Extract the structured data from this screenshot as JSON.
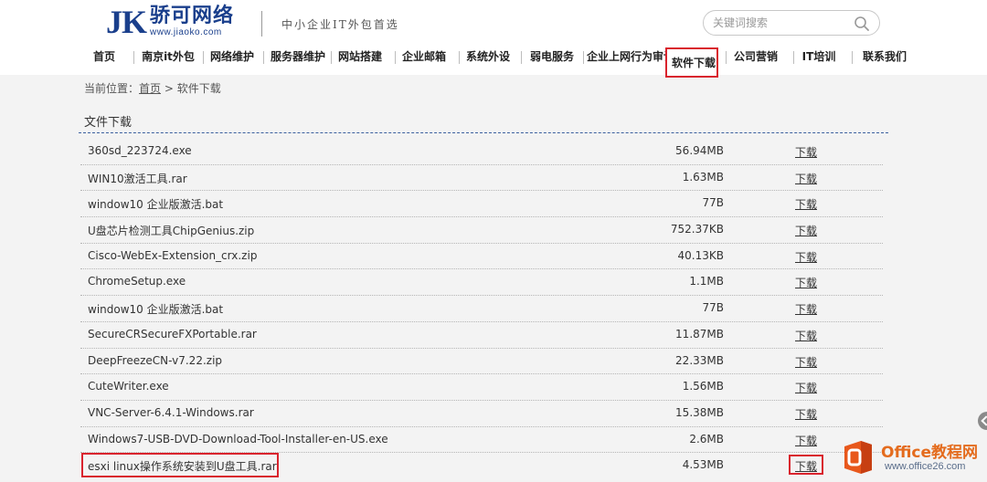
{
  "brand": {
    "logo_mark": "JK",
    "logo_name": "骄可网络",
    "logo_url": "www.jiaoko.com",
    "slogan": "中小企业IT外包首选"
  },
  "search": {
    "placeholder": "关键词搜索",
    "icon": "search-icon"
  },
  "nav": {
    "items": [
      {
        "label": "首页"
      },
      {
        "label": "南京it外包"
      },
      {
        "label": "网络维护"
      },
      {
        "label": "服务器维护"
      },
      {
        "label": "网站搭建"
      },
      {
        "label": "企业邮箱"
      },
      {
        "label": "系统外设"
      },
      {
        "label": "弱电服务"
      },
      {
        "label": "企业上网行为审计"
      },
      {
        "label": "软件下载",
        "active": true
      },
      {
        "label": "公司营销"
      },
      {
        "label": "IT培训"
      },
      {
        "label": "联系我们"
      }
    ]
  },
  "breadcrumb": {
    "prefix": "当前位置：",
    "home": "首页",
    "separator": ">",
    "current": "软件下载"
  },
  "section": {
    "title": "文件下载"
  },
  "files": [
    {
      "name": "360sd_223724.exe",
      "size": "56.94MB",
      "action": "下载"
    },
    {
      "name": "WIN10激活工具.rar",
      "size": "1.63MB",
      "action": "下载"
    },
    {
      "name": "window10 企业版激活.bat",
      "size": "77B",
      "action": "下载"
    },
    {
      "name": "U盘芯片检测工具ChipGenius.zip",
      "size": "752.37KB",
      "action": "下载"
    },
    {
      "name": "Cisco-WebEx-Extension_crx.zip",
      "size": "40.13KB",
      "action": "下载"
    },
    {
      "name": "ChromeSetup.exe",
      "size": "1.1MB",
      "action": "下载"
    },
    {
      "name": "window10 企业版激活.bat",
      "size": "77B",
      "action": "下载"
    },
    {
      "name": "SecureCRSecureFXPortable.rar",
      "size": "11.87MB",
      "action": "下载"
    },
    {
      "name": "DeepFreezeCN-v7.22.zip",
      "size": "22.33MB",
      "action": "下载"
    },
    {
      "name": "CuteWriter.exe",
      "size": "1.56MB",
      "action": "下载"
    },
    {
      "name": "VNC-Server-6.4.1-Windows.rar",
      "size": "15.38MB",
      "action": "下载"
    },
    {
      "name": "Windows7-USB-DVD-Download-Tool-Installer-en-US.exe",
      "size": "2.6MB",
      "action": "下载"
    },
    {
      "name": "esxi linux操作系统安装到U盘工具.rar",
      "size": "4.53MB",
      "action": "下载"
    }
  ],
  "watermark": {
    "title": "Office教程网",
    "url": "www.office26.com"
  },
  "colors": {
    "brand_blue": "#1a3f8c",
    "highlight_red": "#d9232d",
    "watermark_orange": "#e46c1e"
  }
}
